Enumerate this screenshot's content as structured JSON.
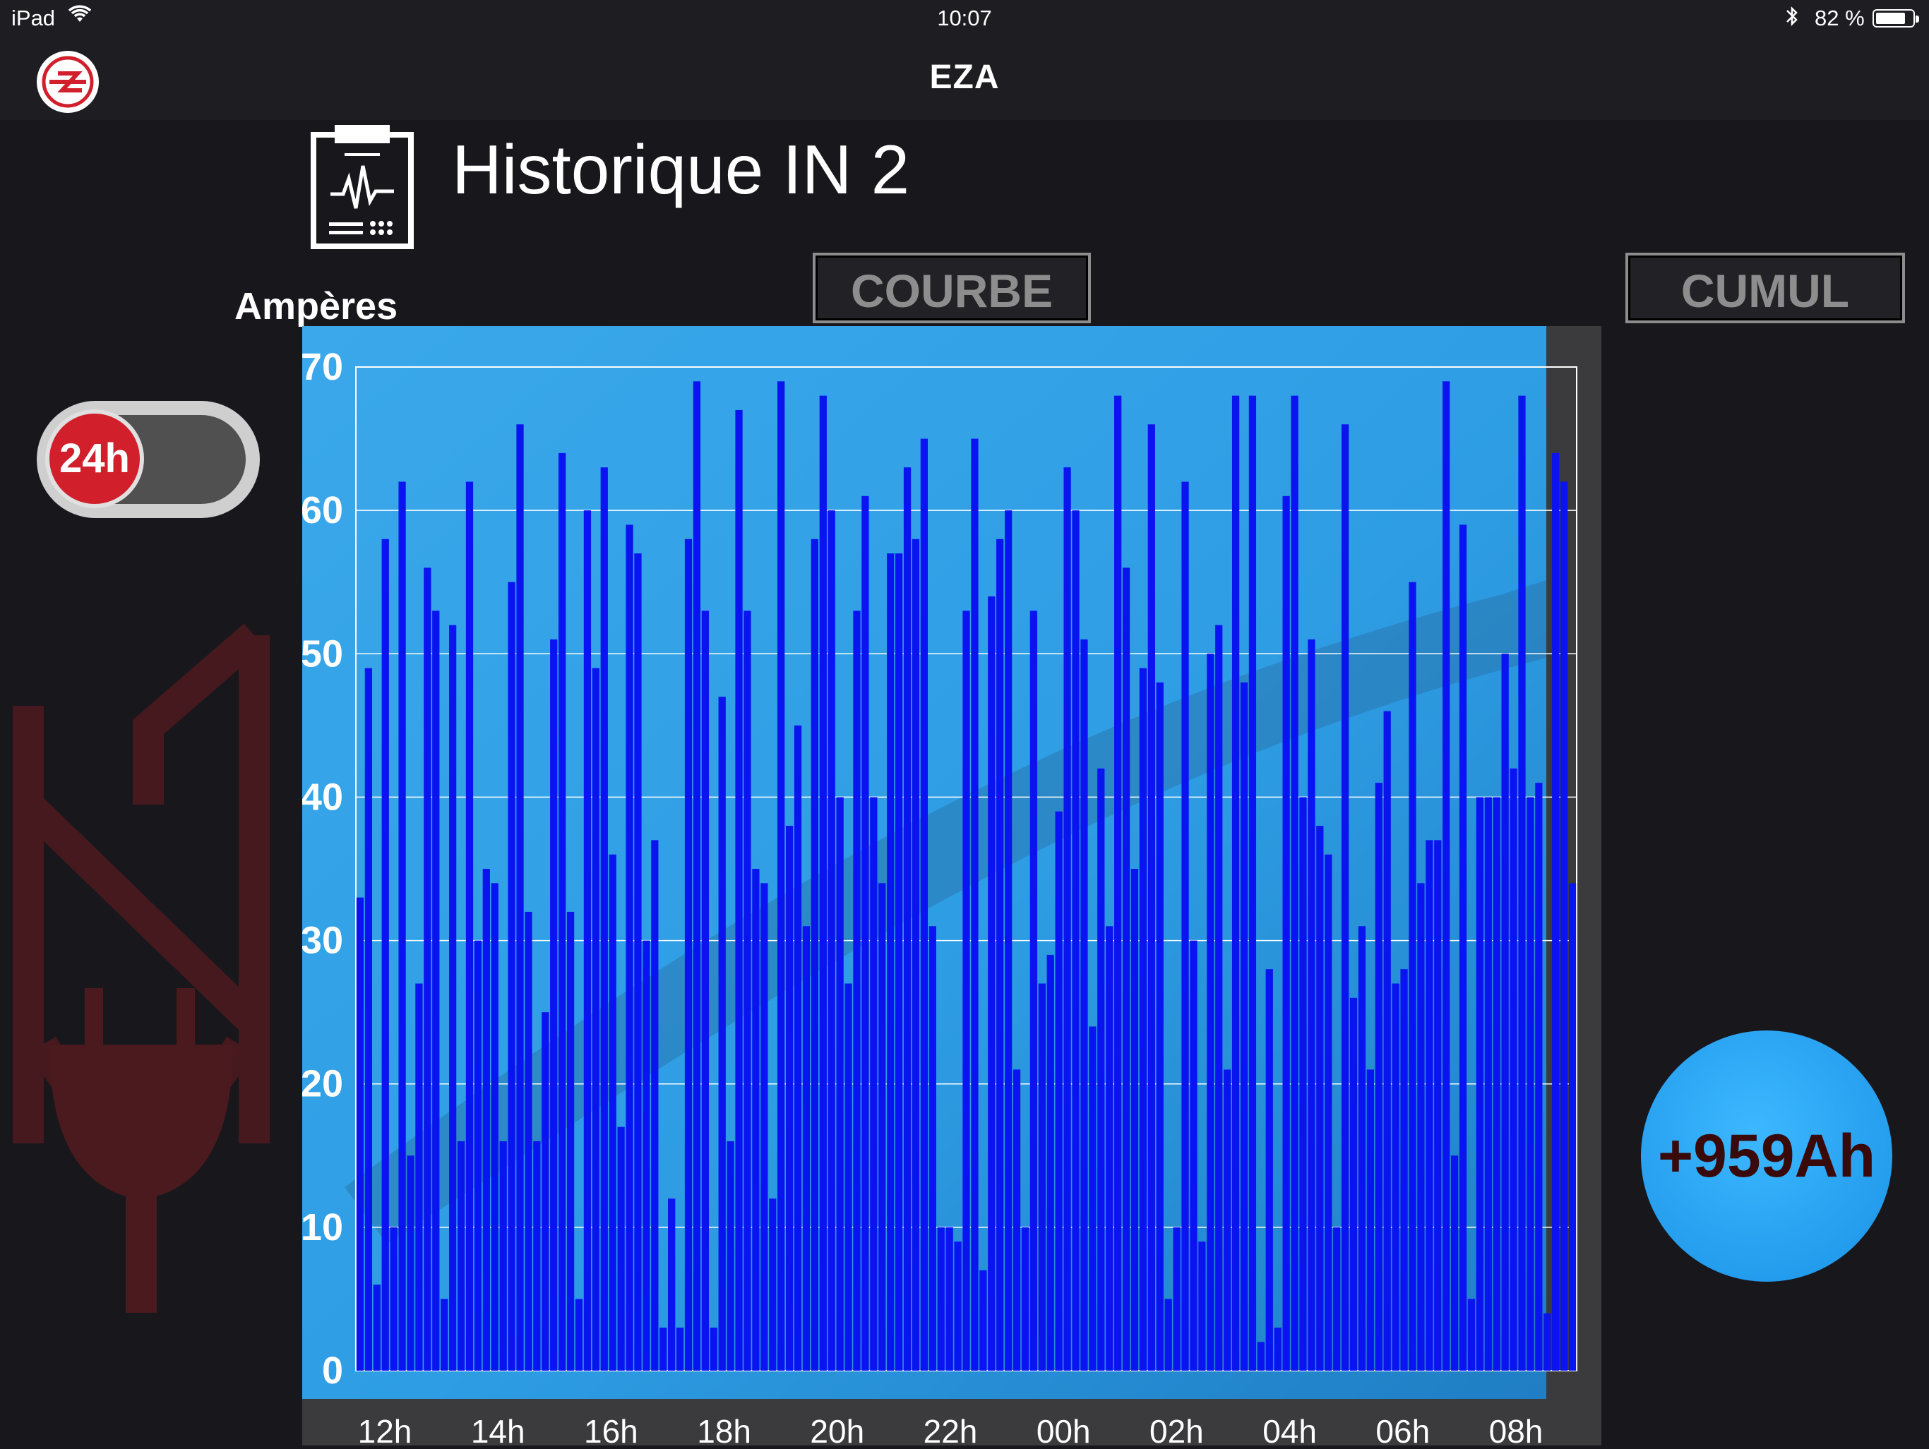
{
  "status_bar": {
    "device": "iPad",
    "time": "10:07",
    "battery_text": "82 %",
    "battery_level": 0.82
  },
  "nav": {
    "title": "EZA"
  },
  "header": {
    "title": "Historique IN 2"
  },
  "buttons": {
    "courbe": "COURBE",
    "cumul": "CUMUL"
  },
  "period_toggle": {
    "label": "24h"
  },
  "total": {
    "label": "+959Ah"
  },
  "colors": {
    "bar": "#0a14f0",
    "accent_red": "#d1202b",
    "total_circle": "#2aa6f5",
    "plot_bg": "#2f9fe6"
  },
  "chart_data": {
    "type": "bar",
    "title": "",
    "ylabel": "Ampères",
    "xlabel": "",
    "ylim": [
      0,
      70
    ],
    "yticks": [
      0,
      10,
      20,
      30,
      40,
      50,
      60,
      70
    ],
    "xtick_labels": [
      "12h",
      "14h",
      "16h",
      "18h",
      "20h",
      "22h",
      "00h",
      "02h",
      "04h",
      "06h",
      "08h"
    ],
    "grid": true,
    "values": [
      33,
      49,
      6,
      58,
      10,
      62,
      15,
      27,
      56,
      53,
      5,
      52,
      16,
      62,
      30,
      35,
      34,
      16,
      55,
      66,
      32,
      16,
      25,
      51,
      64,
      32,
      5,
      60,
      49,
      63,
      36,
      17,
      59,
      57,
      30,
      37,
      3,
      12,
      3,
      58,
      69,
      53,
      3,
      47,
      16,
      67,
      53,
      35,
      34,
      12,
      69,
      38,
      45,
      31,
      58,
      68,
      60,
      40,
      27,
      53,
      61,
      40,
      34,
      57,
      57,
      63,
      58,
      65,
      31,
      10,
      10,
      9,
      53,
      65,
      7,
      54,
      58,
      60,
      21,
      10,
      53,
      27,
      29,
      39,
      63,
      60,
      51,
      24,
      42,
      31,
      68,
      56,
      35,
      49,
      66,
      48,
      5,
      10,
      62,
      30,
      9,
      50,
      52,
      21,
      68,
      48,
      68,
      2,
      28,
      3,
      61,
      68,
      40,
      51,
      38,
      36,
      10,
      66,
      26,
      31,
      21,
      41,
      46,
      27,
      28,
      55,
      34,
      37,
      37,
      69,
      15,
      59,
      5,
      40,
      40,
      40,
      50,
      42,
      68,
      40,
      41,
      4,
      64,
      62,
      34
    ]
  }
}
